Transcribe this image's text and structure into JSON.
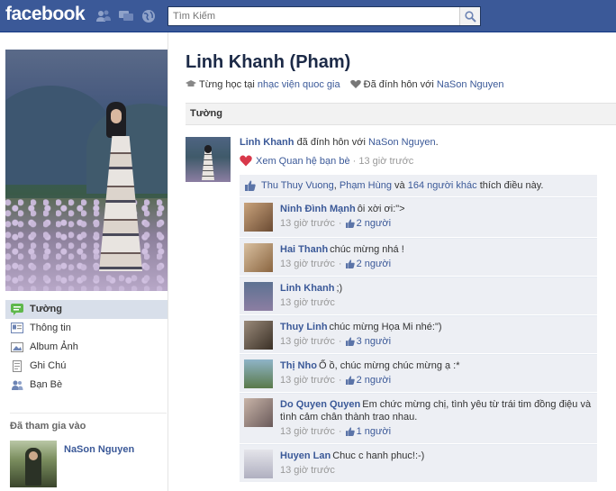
{
  "header": {
    "logo": "facebook",
    "search_placeholder": "Tìm Kiếm"
  },
  "nav": {
    "items": [
      {
        "label": "Tường",
        "active": true,
        "icon": "wall-icon"
      },
      {
        "label": "Thông tin",
        "active": false,
        "icon": "info-icon"
      },
      {
        "label": "Album Ảnh",
        "active": false,
        "icon": "photos-icon"
      },
      {
        "label": "Ghi Chú",
        "active": false,
        "icon": "notes-icon"
      },
      {
        "label": "Bạn Bè",
        "active": false,
        "icon": "friends-icon"
      }
    ]
  },
  "joined": {
    "title": "Đã tham gia vào",
    "name": "NaSon Nguyen"
  },
  "profile": {
    "name": "Linh Khanh (Pham)",
    "studied_prefix": "Từng học tại",
    "school": "nhạc viện quoc gia",
    "engaged_prefix": "Đã đính hôn với",
    "partner": "NaSon Nguyen"
  },
  "wall_tab": "Tường",
  "post": {
    "actor": "Linh Khanh",
    "action": "đã đính hôn với",
    "target": "NaSon Nguyen",
    "target_suffix": ".",
    "view_link": "Xem Quan hệ bạn bè",
    "separator": "·",
    "time": "13 giờ trước",
    "likes": {
      "name1": "Thu Thuy Vuong",
      "comma": ",",
      "name2": "Phạm Hùng",
      "and": "và",
      "others": "164 người khác",
      "suffix": "thích điều này."
    }
  },
  "comments": [
    {
      "name": "Ninh Đình Mạnh",
      "text": "ôi xời ơi:\">",
      "time": "13 giờ trước",
      "likes": "2 người"
    },
    {
      "name": "Hai Thanh",
      "text": "chúc mừng nhá !",
      "time": "13 giờ trước",
      "likes": "2 người"
    },
    {
      "name": "Linh Khanh",
      "text": ";)",
      "time": "13 giờ trước",
      "likes": ""
    },
    {
      "name": "Thuy Linh",
      "text": "chúc mừng Họa Mi nhé:\")",
      "time": "13 giờ trước",
      "likes": "3 người"
    },
    {
      "name": "Thị Nho",
      "text": "Ố ồ, chúc mừng chúc mừng ạ :*",
      "time": "13 giờ trước",
      "likes": "2 người"
    },
    {
      "name": "Do Quyen Quyen",
      "text": "Em chức mừng chị, tình yêu từ trái tim đồng điệu và tình cảm chân thành trao nhau.",
      "time": "13 giờ trước",
      "likes": "1 người"
    },
    {
      "name": "Huyen Lan",
      "text": "Chuc c hanh phuc!:-)",
      "time": "13 giờ trước",
      "likes": ""
    }
  ],
  "colors": {
    "brand": "#3b5998",
    "heart": "#d8384a",
    "comment_bg": "#edeff4"
  }
}
